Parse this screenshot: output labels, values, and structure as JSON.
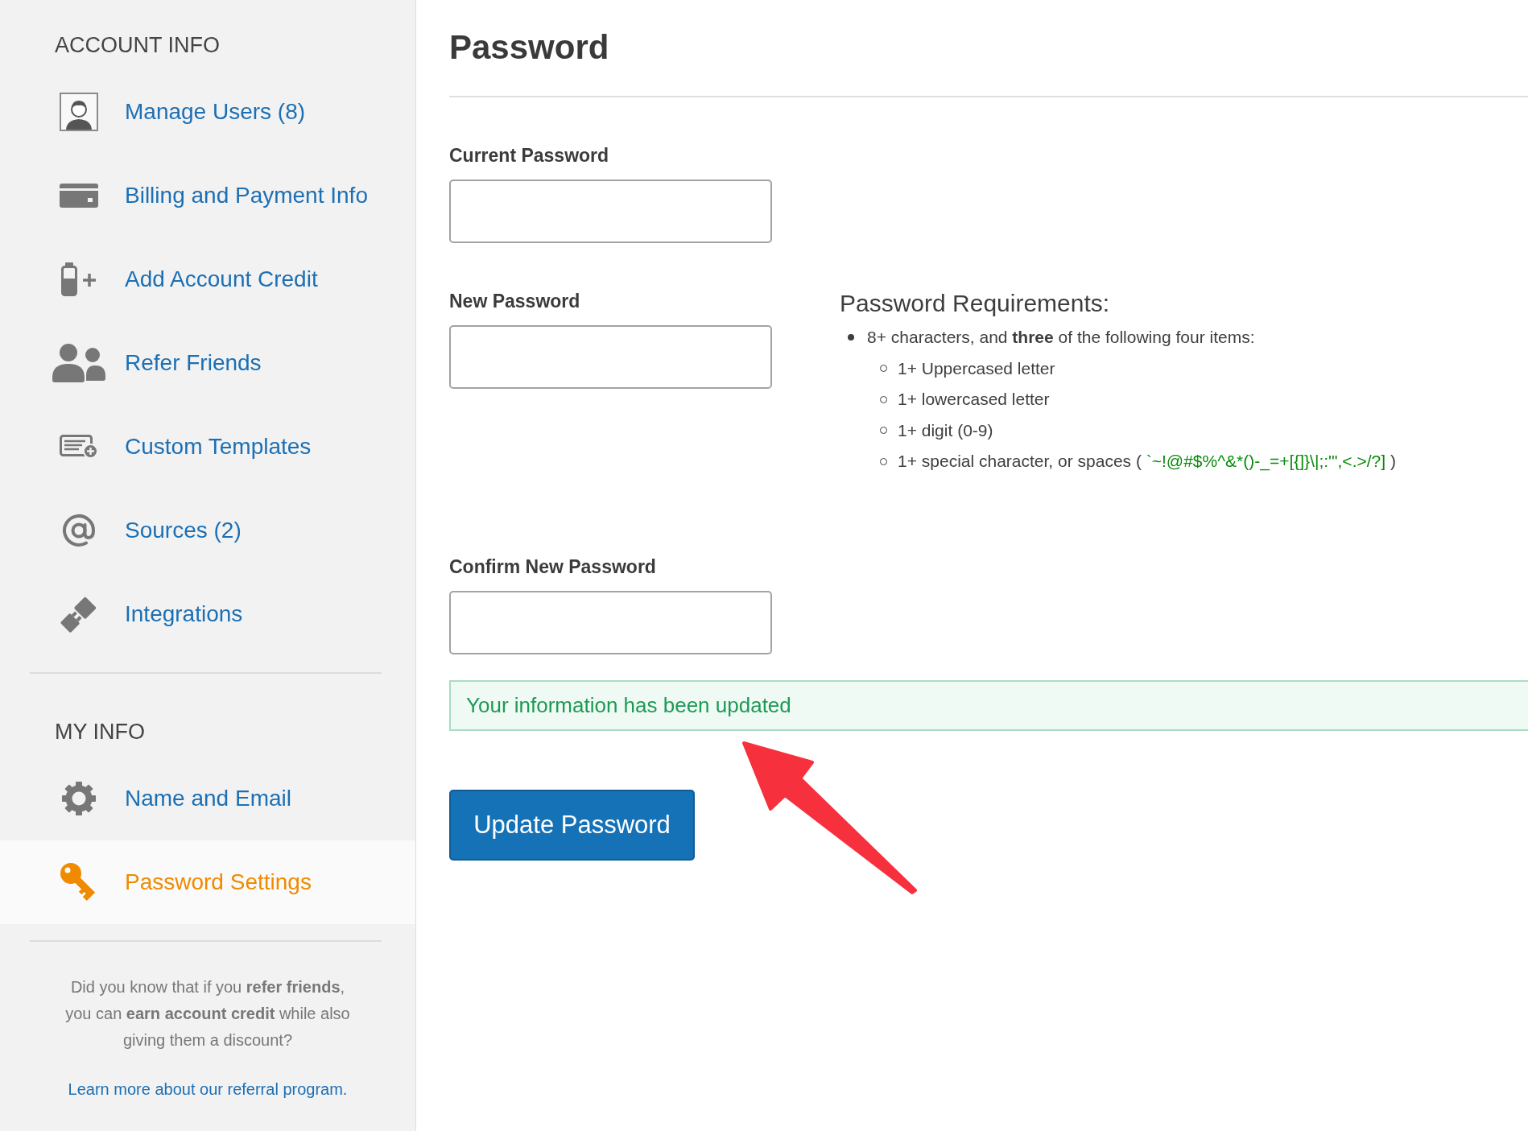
{
  "sidebar": {
    "sections": [
      {
        "heading": "ACCOUNT INFO",
        "items": [
          {
            "label": "Manage Users (8)",
            "selected": false
          },
          {
            "label": "Billing and Payment Info",
            "selected": false
          },
          {
            "label": "Add Account Credit",
            "selected": false
          },
          {
            "label": "Refer Friends",
            "selected": false
          },
          {
            "label": "Custom Templates",
            "selected": false
          },
          {
            "label": "Sources (2)",
            "selected": false
          },
          {
            "label": "Integrations",
            "selected": false
          }
        ]
      },
      {
        "heading": "MY INFO",
        "items": [
          {
            "label": "Name and Email",
            "selected": false
          },
          {
            "label": "Password Settings",
            "selected": true
          }
        ]
      }
    ],
    "promo": {
      "text": "Did you know that if you **refer friends**, you can **earn account credit** while also giving them a discount?",
      "link": "Learn more about our referral program."
    }
  },
  "page": {
    "title": "Password",
    "fields": [
      {
        "label": "Current Password"
      },
      {
        "label": "New Password",
        "requirements": {
          "title": "Password Requirements:",
          "items": [
            {
              "text": "8+ characters, and **three** of the following four items:",
              "children": [
                {
                  "text": "1+ Uppercased letter"
                },
                {
                  "text": "1+ lowercased letter"
                },
                {
                  "text": "1+ digit (0-9)"
                },
                {
                  "text": "1+ special character, or spaces (",
                  "symbols": "`~!@#$%^&*()-_=+[{]}\\|;:'\",<.>/?]",
                  "suffix": ")"
                }
              ]
            }
          ]
        }
      },
      {
        "label": "Confirm New Password"
      }
    ],
    "message": {
      "kind": "success",
      "text": "Your information has been updated"
    },
    "submit": {
      "label": "Update Password"
    }
  },
  "annotations": [
    {
      "kind": "arrow"
    }
  ]
}
